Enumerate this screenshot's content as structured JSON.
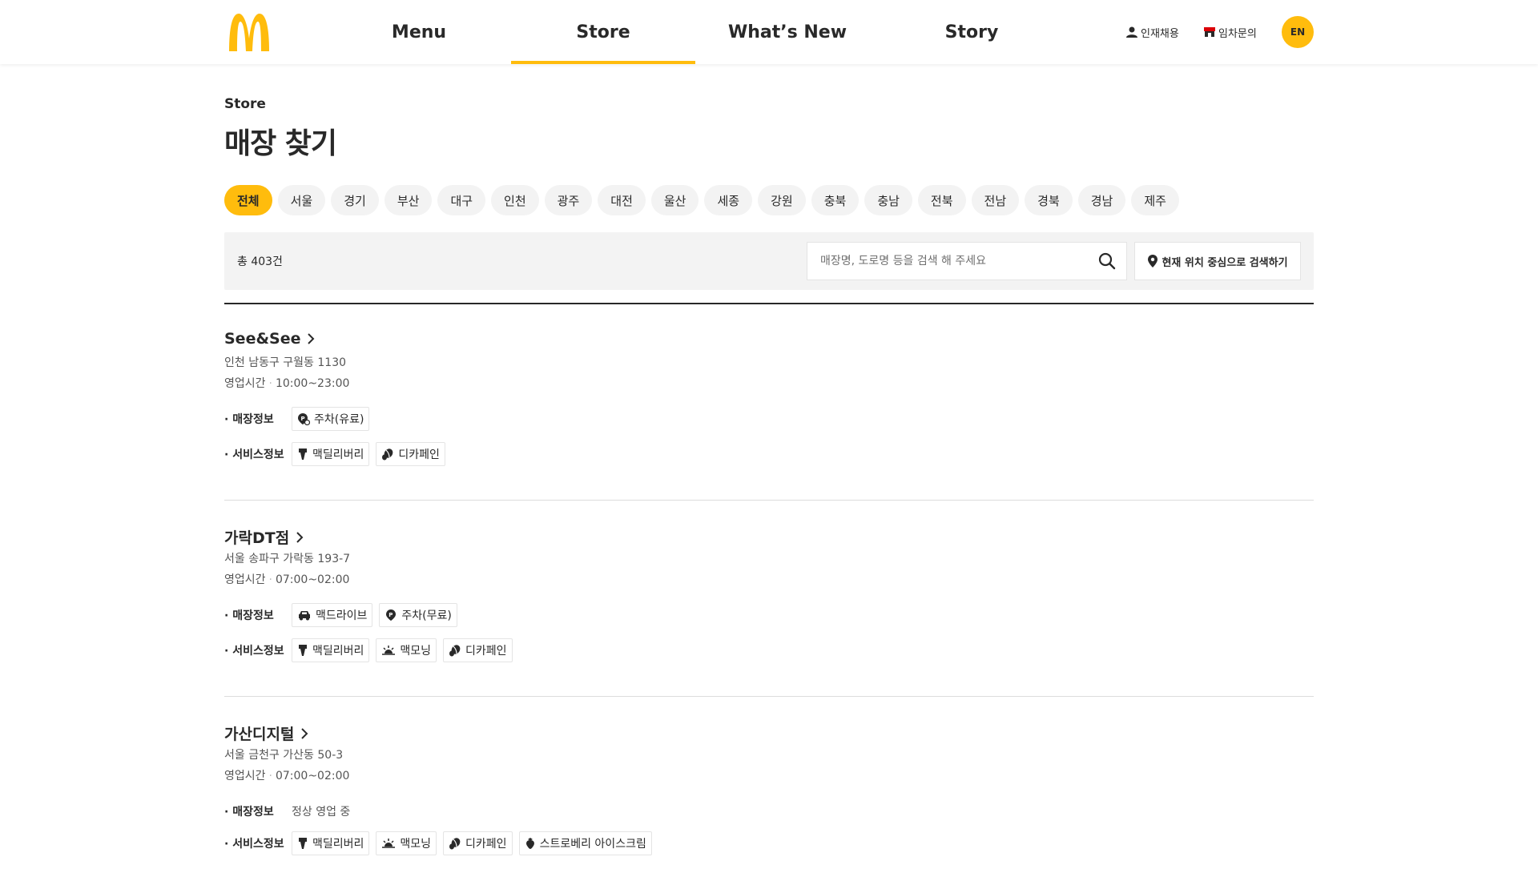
{
  "header": {
    "nav": [
      "Menu",
      "Store",
      "What’s New",
      "Story"
    ],
    "active_nav": "Store",
    "util_hire": "인재채용",
    "util_lease": "임차문의",
    "lang": "EN",
    "brand_color": "#ffbc0d"
  },
  "page": {
    "crumb": "Store",
    "title": "매장 찾기"
  },
  "regions": [
    "전체",
    "서울",
    "경기",
    "부산",
    "대구",
    "인천",
    "광주",
    "대전",
    "울산",
    "세종",
    "강원",
    "충북",
    "충남",
    "전북",
    "전남",
    "경북",
    "경남",
    "제주"
  ],
  "active_region": "전체",
  "search": {
    "total": "총 403건",
    "placeholder": "매장명, 도로명 등을 검색 해 주세요",
    "location_button": "현재 위치 중심으로 검색하기"
  },
  "labels": {
    "hours": "영업시간",
    "store_info": "· 매장정보",
    "service_info": "· 서비스정보"
  },
  "stores": [
    {
      "name": "See&See",
      "address": "인천 남동구 구월동 1130",
      "hours": "10:00~23:00",
      "store_tags": [
        {
          "icon": "parking-paid-icon",
          "label": "주차(유료)"
        }
      ],
      "store_text": "",
      "service_tags": [
        {
          "icon": "delivery-icon",
          "label": "맥딜리버리"
        },
        {
          "icon": "decaf-icon",
          "label": "디카페인"
        }
      ]
    },
    {
      "name": "가락DT점",
      "address": "서울 송파구 가락동 193-7",
      "hours": "07:00~02:00",
      "store_tags": [
        {
          "icon": "drive-thru-icon",
          "label": "맥드라이브"
        },
        {
          "icon": "parking-free-icon",
          "label": "주차(무료)"
        }
      ],
      "store_text": "",
      "service_tags": [
        {
          "icon": "delivery-icon",
          "label": "맥딜리버리"
        },
        {
          "icon": "morning-icon",
          "label": "맥모닝"
        },
        {
          "icon": "decaf-icon",
          "label": "디카페인"
        }
      ]
    },
    {
      "name": "가산디지털",
      "address": "서울 금천구 가산동 50-3",
      "hours": "07:00~02:00",
      "store_tags": [],
      "store_text": "정상 영업 중",
      "service_tags": [
        {
          "icon": "delivery-icon",
          "label": "맥딜리버리"
        },
        {
          "icon": "morning-icon",
          "label": "맥모닝"
        },
        {
          "icon": "decaf-icon",
          "label": "디카페인"
        },
        {
          "icon": "strawberry-icon",
          "label": "스트로베리 아이스크림"
        }
      ]
    }
  ]
}
